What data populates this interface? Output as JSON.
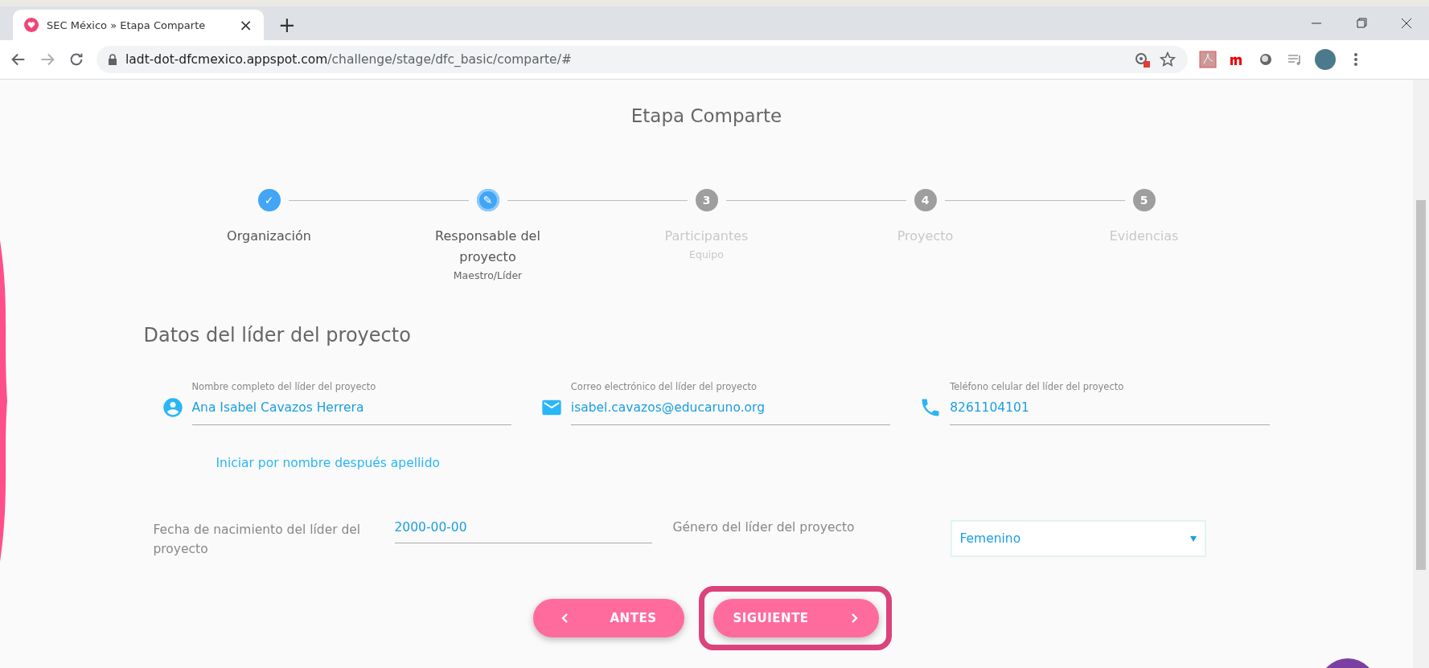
{
  "browser": {
    "tab_title": "SEC México » Etapa Comparte",
    "tab_close": "×",
    "new_tab": "+",
    "url_host": "ladt-dot-dfcmexico.appspot.com",
    "url_path": "/challenge/stage/dfc_basic/comparte/#",
    "forward_disabled": true
  },
  "page": {
    "title": "Etapa Comparte",
    "steps": [
      {
        "done": true,
        "selected": false,
        "marker": "✓",
        "label": "Organización"
      },
      {
        "done": false,
        "selected": true,
        "marker": "✎",
        "label": "Responsable del proyecto",
        "sublabel": "Maestro/Líder"
      },
      {
        "done": false,
        "selected": false,
        "marker": "3",
        "label": "Participantes",
        "sublabel": "Equipo"
      },
      {
        "done": false,
        "selected": false,
        "marker": "4",
        "label": "Proyecto"
      },
      {
        "done": false,
        "selected": false,
        "marker": "5",
        "label": "Evidencias"
      }
    ],
    "section_title": "Datos del líder del proyecto",
    "fields": [
      {
        "kind": "person",
        "label": "Nombre completo del líder del proyecto",
        "value": "Ana Isabel Cavazos Herrera"
      },
      {
        "kind": "email",
        "label": "Correo electrónico del líder del proyecto",
        "value": "isabel.cavazos@educaruno.org"
      },
      {
        "kind": "phone",
        "label": "Teléfono celular del líder del proyecto",
        "value": "8261104101"
      }
    ],
    "hint": "Iniciar por nombre después apellido",
    "birth_label": "Fecha de nacimiento del líder del proyecto",
    "birth_value": "2000-00-00",
    "gender_label": "Género del líder del proyecto",
    "gender_value": "Femenino",
    "buttons": [
      {
        "kind": "back",
        "label": "ANTES",
        "highlighted": false
      },
      {
        "kind": "next",
        "label": "SIGUIENTE",
        "highlighted": true
      }
    ]
  }
}
